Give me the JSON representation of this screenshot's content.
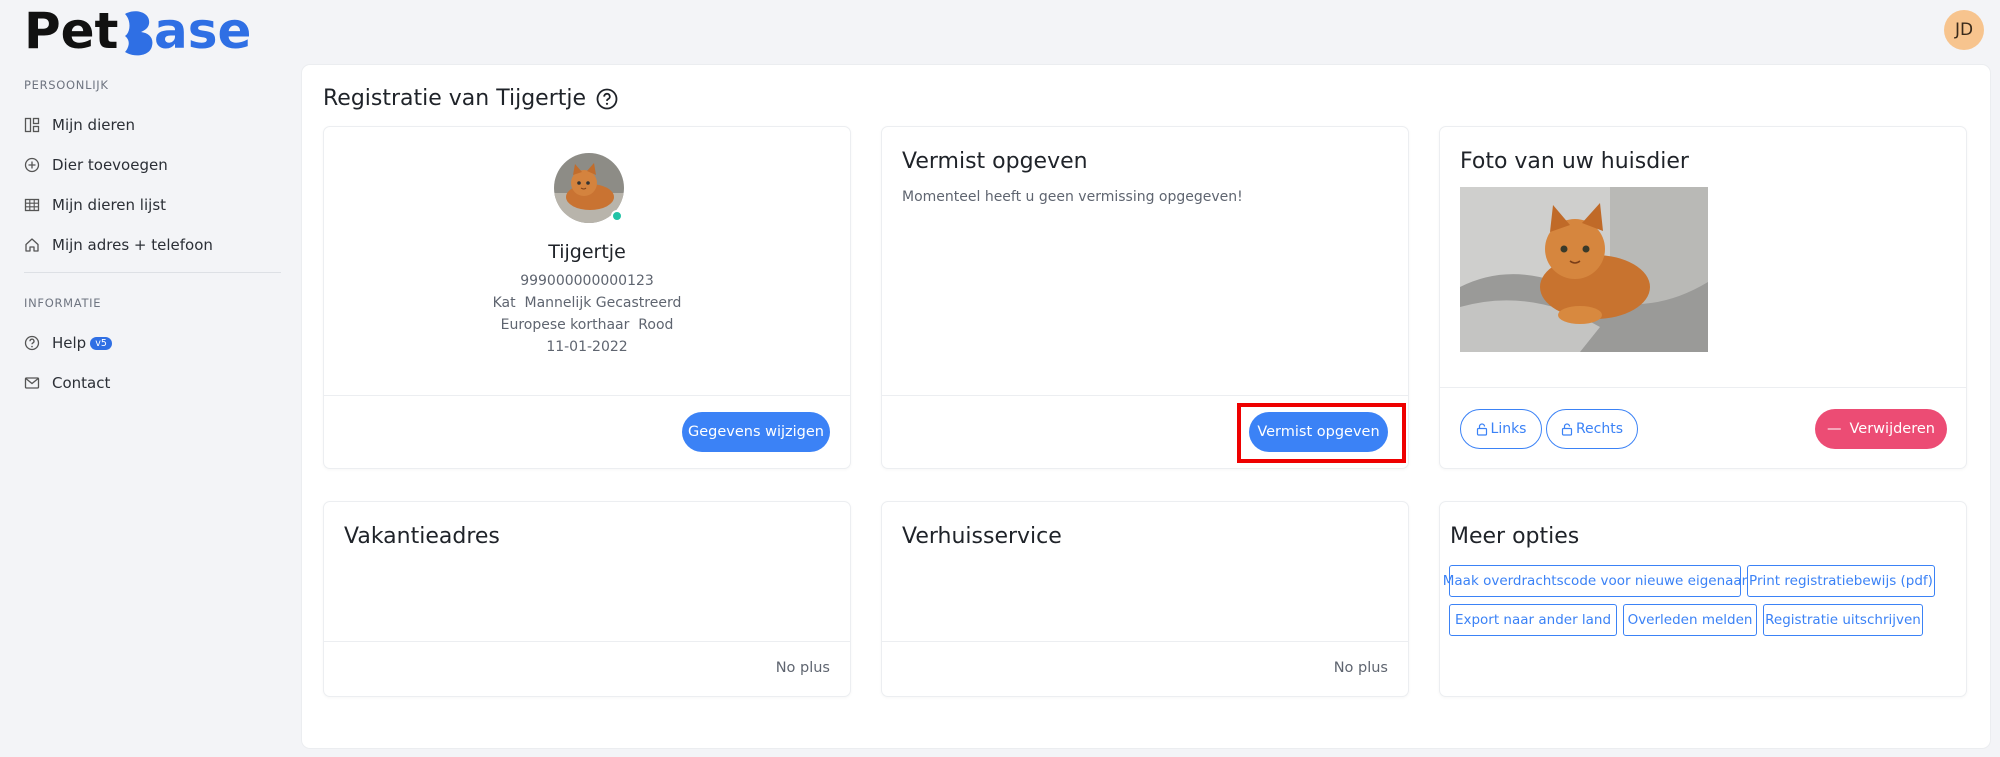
{
  "app": {
    "logo_text": "PetBase",
    "user_initials": "JD"
  },
  "sidebar": {
    "section_personal": "PERSOONLIJK",
    "items_personal": [
      {
        "label": "Mijn dieren",
        "icon": "dashboard-icon"
      },
      {
        "label": "Dier toevoegen",
        "icon": "plus-circle-icon"
      },
      {
        "label": "Mijn dieren lijst",
        "icon": "table-icon"
      },
      {
        "label": "Mijn adres + telefoon",
        "icon": "home-icon"
      }
    ],
    "section_info": "INFORMATIE",
    "items_info": [
      {
        "label": "Help",
        "icon": "help-circle-icon",
        "badge": "v5"
      },
      {
        "label": "Contact",
        "icon": "mail-icon"
      }
    ]
  },
  "page": {
    "title": "Registratie van Tijgertje"
  },
  "pet_card": {
    "name": "Tijgertje",
    "chip": "999000000000123",
    "species_line": "Kat  Mannelijk Gecastreerd",
    "breed_line": "Europese korthaar  Rood",
    "birthdate": "11-01-2022",
    "edit_button": "Gegevens wijzigen"
  },
  "missing_card": {
    "title": "Vermist opgeven",
    "text": "Momenteel heeft u geen vermissing opgegeven!",
    "button": "Vermist opgeven"
  },
  "photo_card": {
    "title": "Foto van uw huisdier",
    "left_button": "Links",
    "right_button": "Rechts",
    "delete_button": "Verwijderen"
  },
  "vacation_card": {
    "title": "Vakantieadres",
    "footer": "No plus"
  },
  "moving_card": {
    "title": "Verhuisservice",
    "footer": "No plus"
  },
  "options_card": {
    "title": "Meer opties",
    "options": [
      "Maak overdrachtscode voor nieuwe eigenaar",
      "Print registratiebewijs (pdf)",
      "Export naar ander land",
      "Overleden melden",
      "Registratie uitschrijven"
    ]
  },
  "colors": {
    "primary": "#3b82f6",
    "danger": "#ec4c74",
    "online": "#22c3a6",
    "highlight": "#e00000"
  }
}
